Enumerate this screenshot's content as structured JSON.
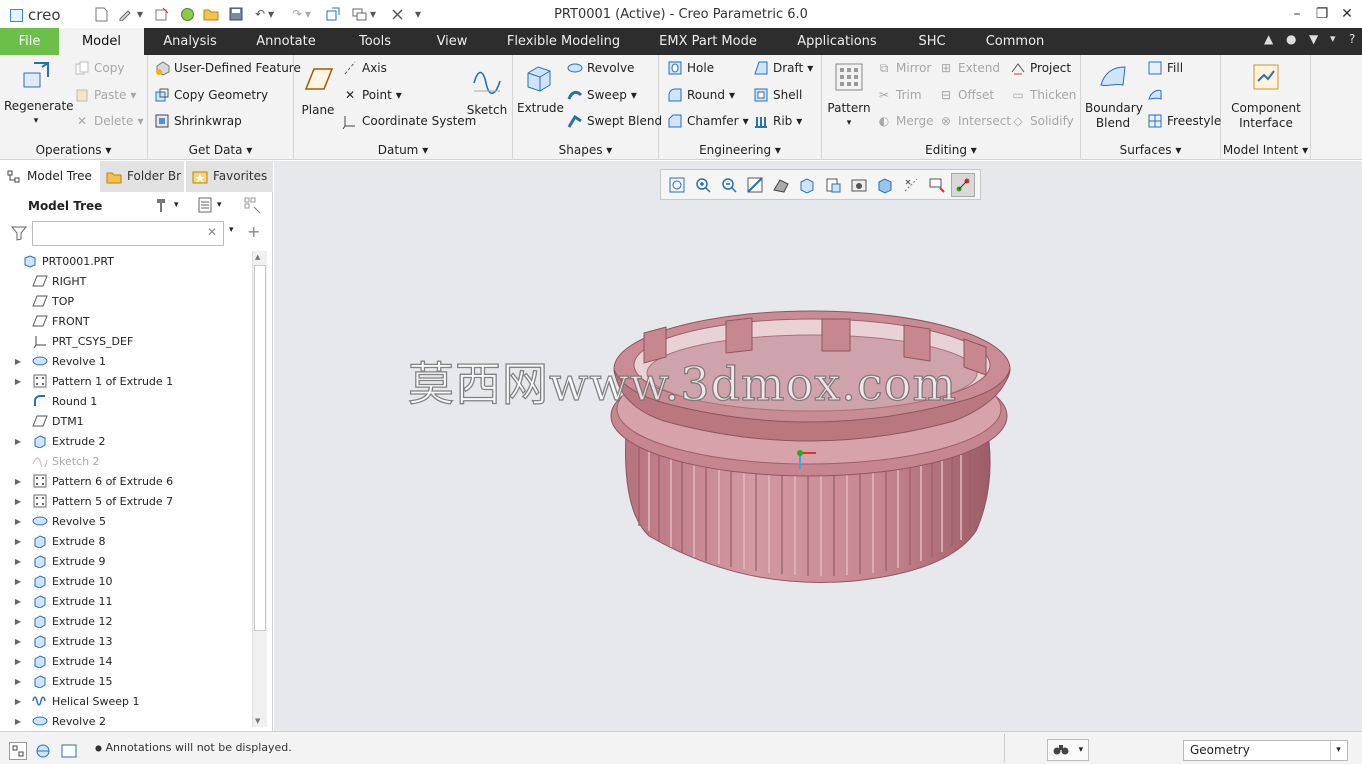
{
  "app": {
    "logo_text": "creo",
    "window_title": "PRT0001 (Active) - Creo Parametric 6.0"
  },
  "tabs": [
    "File",
    "Model",
    "Analysis",
    "Annotate",
    "Tools",
    "View",
    "Flexible Modeling",
    "EMX Part Mode",
    "Applications",
    "SHC",
    "Common"
  ],
  "ribbon": {
    "operations": {
      "label": "Operations",
      "regenerate": "Regenerate",
      "copy": "Copy",
      "paste": "Paste",
      "delete": "Delete"
    },
    "get_data": {
      "label": "Get Data",
      "udf": "User-Defined Feature",
      "copy_geometry": "Copy Geometry",
      "shrinkwrap": "Shrinkwrap"
    },
    "datum": {
      "label": "Datum",
      "plane": "Plane",
      "axis": "Axis",
      "point": "Point",
      "csys": "Coordinate System",
      "sketch": "Sketch"
    },
    "shapes": {
      "label": "Shapes",
      "extrude": "Extrude",
      "revolve": "Revolve",
      "sweep": "Sweep",
      "swept_blend": "Swept Blend"
    },
    "engineering": {
      "label": "Engineering",
      "hole": "Hole",
      "round": "Round",
      "chamfer": "Chamfer",
      "draft": "Draft",
      "shell": "Shell",
      "rib": "Rib"
    },
    "editing": {
      "label": "Editing",
      "pattern": "Pattern",
      "mirror": "Mirror",
      "trim": "Trim",
      "merge": "Merge",
      "extend": "Extend",
      "offset": "Offset",
      "intersect": "Intersect",
      "project": "Project",
      "thicken": "Thicken",
      "solidify": "Solidify"
    },
    "surfaces": {
      "label": "Surfaces",
      "boundary_blend": "Boundary Blend",
      "fill": "Fill",
      "freestyle": "Freestyle"
    },
    "model_intent": {
      "label": "Model Intent",
      "component_interface": "Component Interface"
    }
  },
  "navigator": {
    "tabs": [
      "Model Tree",
      "Folder Br",
      "Favorites"
    ],
    "tree_title": "Model Tree",
    "items": [
      {
        "label": "PRT0001.PRT",
        "icon": "part-icon",
        "expand": false,
        "indent": 0,
        "dim": false
      },
      {
        "label": "RIGHT",
        "icon": "datum-plane-icon",
        "expand": false,
        "indent": 1,
        "dim": false
      },
      {
        "label": "TOP",
        "icon": "datum-plane-icon",
        "expand": false,
        "indent": 1,
        "dim": false
      },
      {
        "label": "FRONT",
        "icon": "datum-plane-icon",
        "expand": false,
        "indent": 1,
        "dim": false
      },
      {
        "label": "PRT_CSYS_DEF",
        "icon": "csys-icon",
        "expand": false,
        "indent": 1,
        "dim": false
      },
      {
        "label": "Revolve 1",
        "icon": "revolve-icon",
        "expand": true,
        "indent": 1,
        "dim": false
      },
      {
        "label": "Pattern 1 of Extrude 1",
        "icon": "pattern-icon",
        "expand": true,
        "indent": 1,
        "dim": false
      },
      {
        "label": "Round 1",
        "icon": "round-icon",
        "expand": false,
        "indent": 1,
        "dim": false
      },
      {
        "label": "DTM1",
        "icon": "datum-plane-icon",
        "expand": false,
        "indent": 1,
        "dim": false
      },
      {
        "label": "Extrude 2",
        "icon": "extrude-icon",
        "expand": true,
        "indent": 1,
        "dim": false
      },
      {
        "label": "Sketch 2",
        "icon": "sketch-icon",
        "expand": false,
        "indent": 1,
        "dim": true
      },
      {
        "label": "Pattern 6 of Extrude 6",
        "icon": "pattern-icon",
        "expand": true,
        "indent": 1,
        "dim": false
      },
      {
        "label": "Pattern 5 of Extrude 7",
        "icon": "pattern-icon",
        "expand": true,
        "indent": 1,
        "dim": false
      },
      {
        "label": "Revolve 5",
        "icon": "revolve-icon",
        "expand": true,
        "indent": 1,
        "dim": false
      },
      {
        "label": "Extrude 8",
        "icon": "extrude-icon",
        "expand": true,
        "indent": 1,
        "dim": false
      },
      {
        "label": "Extrude 9",
        "icon": "extrude-icon",
        "expand": true,
        "indent": 1,
        "dim": false
      },
      {
        "label": "Extrude 10",
        "icon": "extrude-icon",
        "expand": true,
        "indent": 1,
        "dim": false
      },
      {
        "label": "Extrude 11",
        "icon": "extrude-icon",
        "expand": true,
        "indent": 1,
        "dim": false
      },
      {
        "label": "Extrude 12",
        "icon": "extrude-icon",
        "expand": true,
        "indent": 1,
        "dim": false
      },
      {
        "label": "Extrude 13",
        "icon": "extrude-icon",
        "expand": true,
        "indent": 1,
        "dim": false
      },
      {
        "label": "Extrude 14",
        "icon": "extrude-icon",
        "expand": true,
        "indent": 1,
        "dim": false
      },
      {
        "label": "Extrude 15",
        "icon": "extrude-icon",
        "expand": true,
        "indent": 1,
        "dim": false
      },
      {
        "label": "Helical Sweep 1",
        "icon": "helical-sweep-icon",
        "expand": true,
        "indent": 1,
        "dim": false
      },
      {
        "label": "Revolve 2",
        "icon": "revolve-icon",
        "expand": true,
        "indent": 1,
        "dim": false
      }
    ]
  },
  "graphics": {
    "watermark": "莫西网www.3dmox.com",
    "model_color": "#c88d96"
  },
  "status": {
    "message": "Annotations will not be displayed.",
    "selection_filter": "Geometry"
  },
  "colors": {
    "file_tab": "#6cc04a",
    "tabbar": "#2d2d2d",
    "ribbon": "#f3f3f3",
    "graphics_bg": "#e7e8ec"
  }
}
